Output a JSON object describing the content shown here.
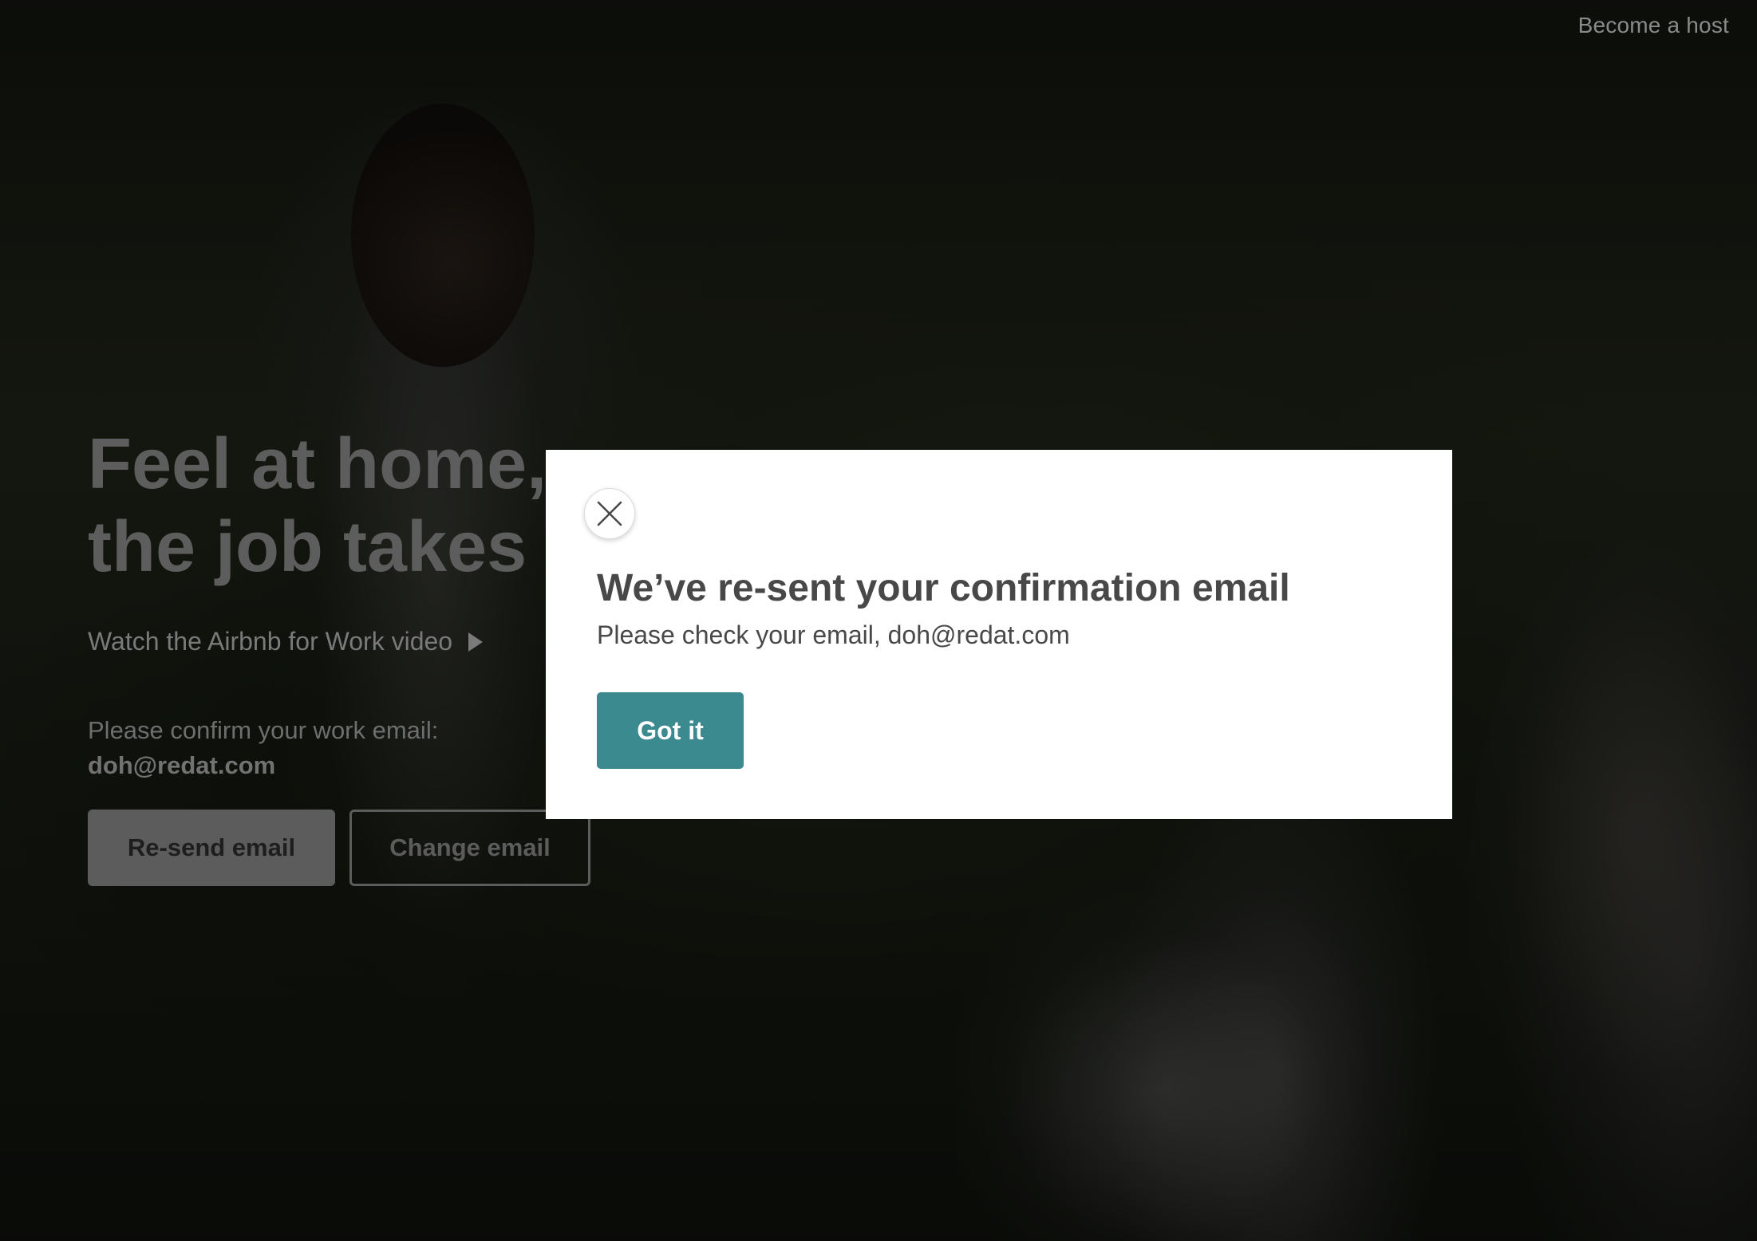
{
  "header": {
    "become_host": "Become a host"
  },
  "hero": {
    "title_line1": "Feel at home, w",
    "title_line2": "the job takes y",
    "video_link": "Watch the Airbnb for Work video",
    "confirm_prompt": "Please confirm your work email:",
    "confirm_email": "doh@redat.com",
    "resend_label": "Re-send email",
    "change_label": "Change email"
  },
  "modal": {
    "title": "We’ve re-sent your confirmation email",
    "subtitle": "Please check your email, doh@redat.com",
    "got_it_label": "Got it"
  },
  "colors": {
    "accent": "#3b8a8f",
    "modal_text": "#484848"
  }
}
